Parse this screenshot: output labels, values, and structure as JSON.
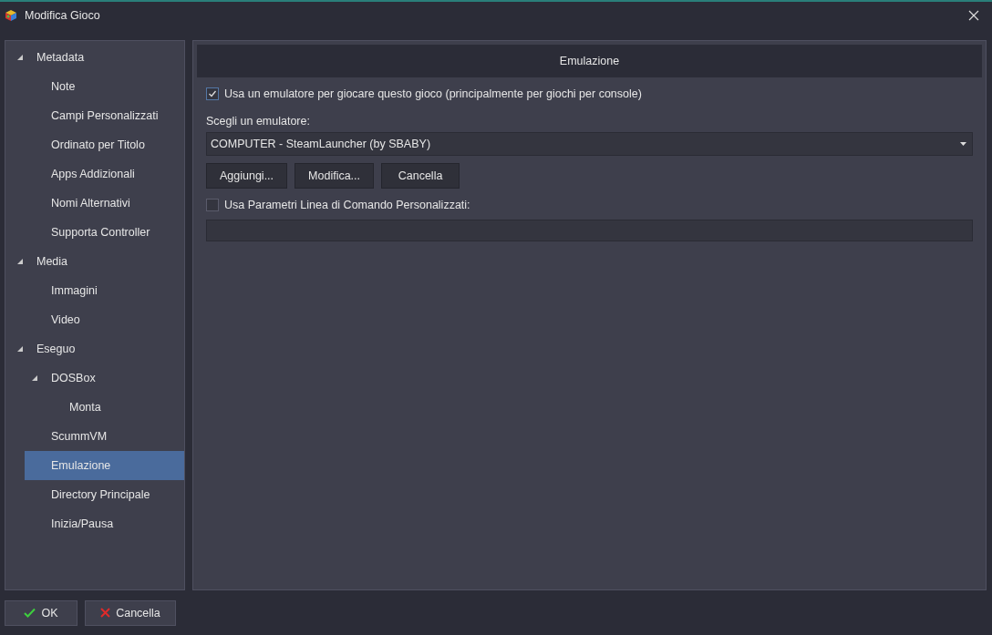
{
  "window": {
    "title": "Modifica Gioco"
  },
  "tree": [
    {
      "label": "Metadata",
      "expanded": true,
      "selected": false,
      "children": [
        {
          "label": "Note",
          "selected": false
        },
        {
          "label": "Campi Personalizzati",
          "selected": false
        },
        {
          "label": "Ordinato per Titolo",
          "selected": false
        },
        {
          "label": "Apps Addizionali",
          "selected": false
        },
        {
          "label": "Nomi Alternativi",
          "selected": false
        },
        {
          "label": "Supporta Controller",
          "selected": false
        }
      ]
    },
    {
      "label": "Media",
      "expanded": true,
      "selected": false,
      "children": [
        {
          "label": "Immagini",
          "selected": false
        },
        {
          "label": "Video",
          "selected": false
        }
      ]
    },
    {
      "label": "Eseguo",
      "expanded": true,
      "selected": false,
      "children": [
        {
          "label": "DOSBox",
          "expanded": true,
          "selected": false,
          "children": [
            {
              "label": "Monta",
              "selected": false
            }
          ]
        },
        {
          "label": "ScummVM",
          "selected": false
        },
        {
          "label": "Emulazione",
          "selected": true
        },
        {
          "label": "Directory Principale",
          "selected": false
        },
        {
          "label": "Inizia/Pausa",
          "selected": false
        }
      ]
    }
  ],
  "section": {
    "title": "Emulazione"
  },
  "use_emulator": {
    "label": "Usa un emulatore per giocare questo gioco (principalmente per giochi per console)",
    "checked": true
  },
  "emulator": {
    "label": "Scegli un emulatore:",
    "value": "COMPUTER - SteamLauncher (by SBABY)"
  },
  "emulator_buttons": [
    "Aggiungi...",
    "Modifica...",
    "Cancella"
  ],
  "custom_params": {
    "label": "Usa Parametri Linea di Comando Personalizzati:",
    "checked": false
  },
  "footer": {
    "ok": "OK",
    "cancel": "Cancella"
  }
}
